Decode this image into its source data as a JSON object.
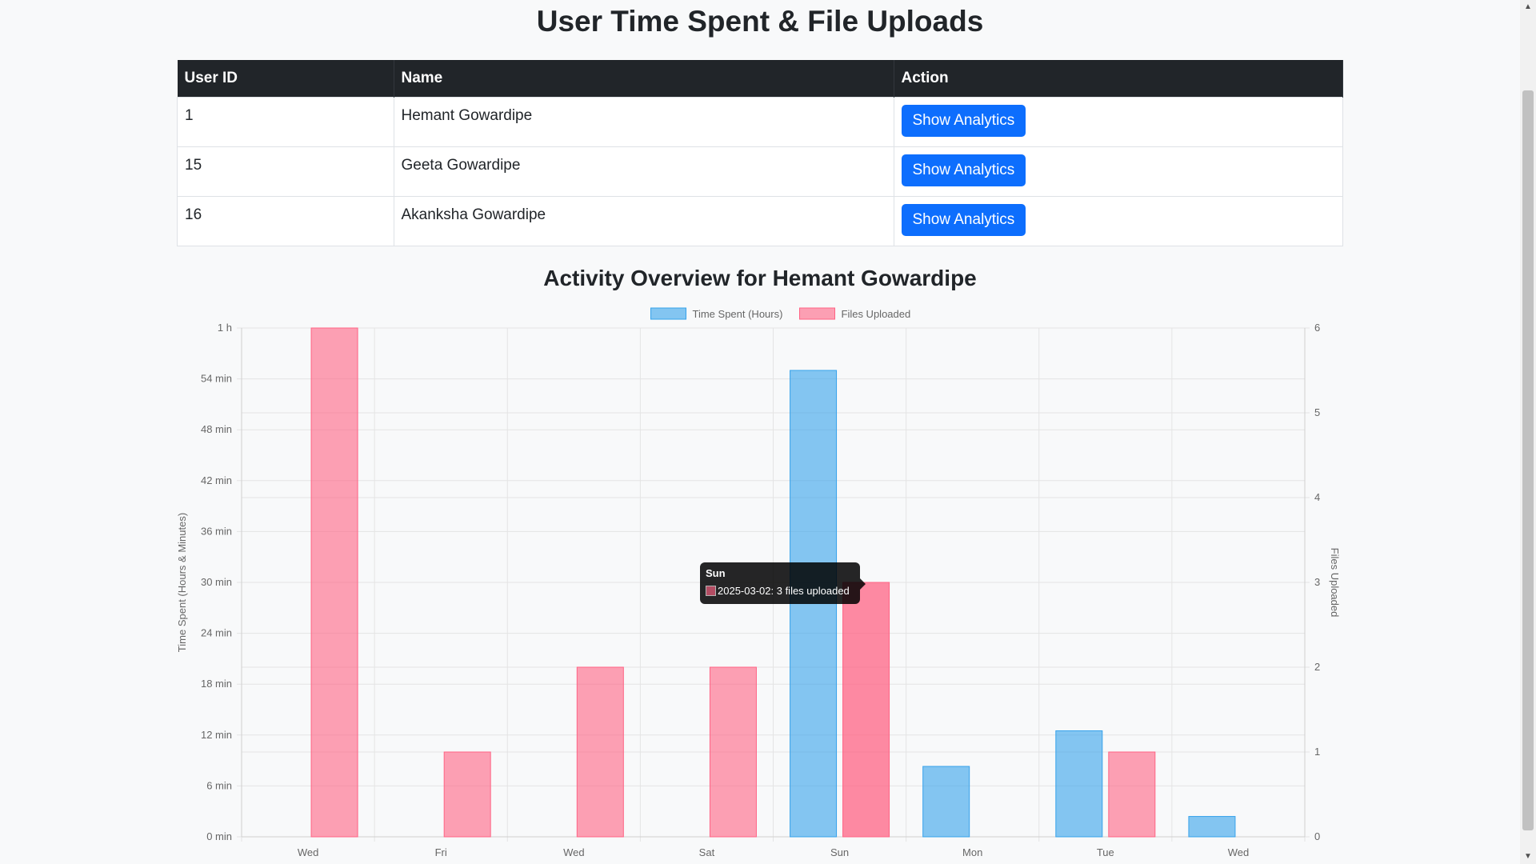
{
  "page": {
    "title": "User Time Spent & File Uploads"
  },
  "table": {
    "headers": [
      "User ID",
      "Name",
      "Action"
    ],
    "rows": [
      {
        "id": "1",
        "name": "Hemant Gowardipe",
        "action": "Show Analytics"
      },
      {
        "id": "15",
        "name": "Geeta Gowardipe",
        "action": "Show Analytics"
      },
      {
        "id": "16",
        "name": "Akanksha Gowardipe",
        "action": "Show Analytics"
      }
    ]
  },
  "chart_section": {
    "title": "Activity Overview for Hemant Gowardipe"
  },
  "tooltip": {
    "title": "Sun",
    "body": "2025-03-02: 3 files uploaded"
  },
  "chart_data": {
    "type": "bar",
    "categories": [
      "Wed",
      "Fri",
      "Wed",
      "Sat",
      "Sun",
      "Mon",
      "Tue",
      "Wed"
    ],
    "series": [
      {
        "name": "Time Spent (Hours)",
        "axis": "left",
        "unit": "minutes",
        "color": "#36a2eb",
        "values": [
          0,
          0,
          0,
          0,
          55,
          8.3,
          12.5,
          2.4
        ]
      },
      {
        "name": "Files Uploaded",
        "axis": "right",
        "unit": "files",
        "color": "#ff6384",
        "values": [
          6,
          1,
          2,
          2,
          3,
          0,
          1,
          0
        ]
      }
    ],
    "ylabel": "Time Spent (Hours & Minutes)",
    "ylim": [
      0,
      60
    ],
    "yticks": [
      "0 min",
      "6 min",
      "12 min",
      "18 min",
      "24 min",
      "30 min",
      "36 min",
      "42 min",
      "48 min",
      "54 min",
      "1 h"
    ],
    "y2label": "Files Uploaded",
    "y2lim": [
      0,
      6
    ],
    "y2ticks": [
      "0",
      "1",
      "2",
      "3",
      "4",
      "5",
      "6"
    ],
    "legend": "top-center",
    "grid": true,
    "highlighted": {
      "category_index": 4,
      "series_index": 1
    }
  }
}
